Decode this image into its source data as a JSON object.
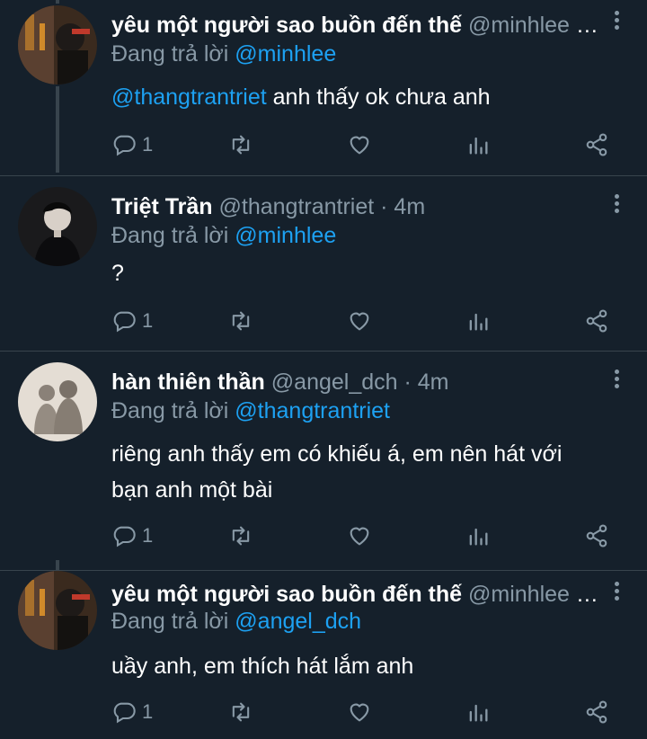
{
  "tweets": [
    {
      "name": "yêu một người sao buồn đến thế",
      "handle": "@minhlee",
      "time": "·…",
      "reply_prefix": "Đang trả lời",
      "reply_to": "@minhlee",
      "body_mention": "@thangtrantriet",
      "body_text": " anh thấy ok chưa anh",
      "reply_count": "1"
    },
    {
      "name": "Triệt Trần",
      "handle": "@thangtrantriet",
      "time": "· 4m",
      "reply_prefix": "Đang trả lời",
      "reply_to": "@minhlee",
      "body_mention": "",
      "body_text": "?",
      "reply_count": "1"
    },
    {
      "name": "hàn thiên thần",
      "handle": "@angel_dch",
      "time": "· 4m",
      "reply_prefix": "Đang trả lời",
      "reply_to": "@thangtrantriet",
      "body_mention": "",
      "body_text": "riêng anh thấy em có khiếu á, em nên hát với bạn anh một bài",
      "reply_count": "1"
    },
    {
      "name": "yêu một người sao buồn đến thế",
      "handle": "@minhlee",
      "time": "·…",
      "reply_prefix": "Đang trả lời",
      "reply_to": "@angel_dch",
      "body_mention": "",
      "body_text": "uầy anh, em thích hát lắm anh",
      "reply_count": "1"
    }
  ],
  "icons": {
    "reply": "reply-icon",
    "retweet": "retweet-icon",
    "like": "heart-icon",
    "stats": "analytics-icon",
    "share": "share-icon",
    "more": "more-vertical-icon"
  },
  "colors": {
    "background": "#15202b",
    "text": "#ffffff",
    "secondary": "#8899a6",
    "accent": "#1da1f2",
    "divider": "#38444d"
  }
}
